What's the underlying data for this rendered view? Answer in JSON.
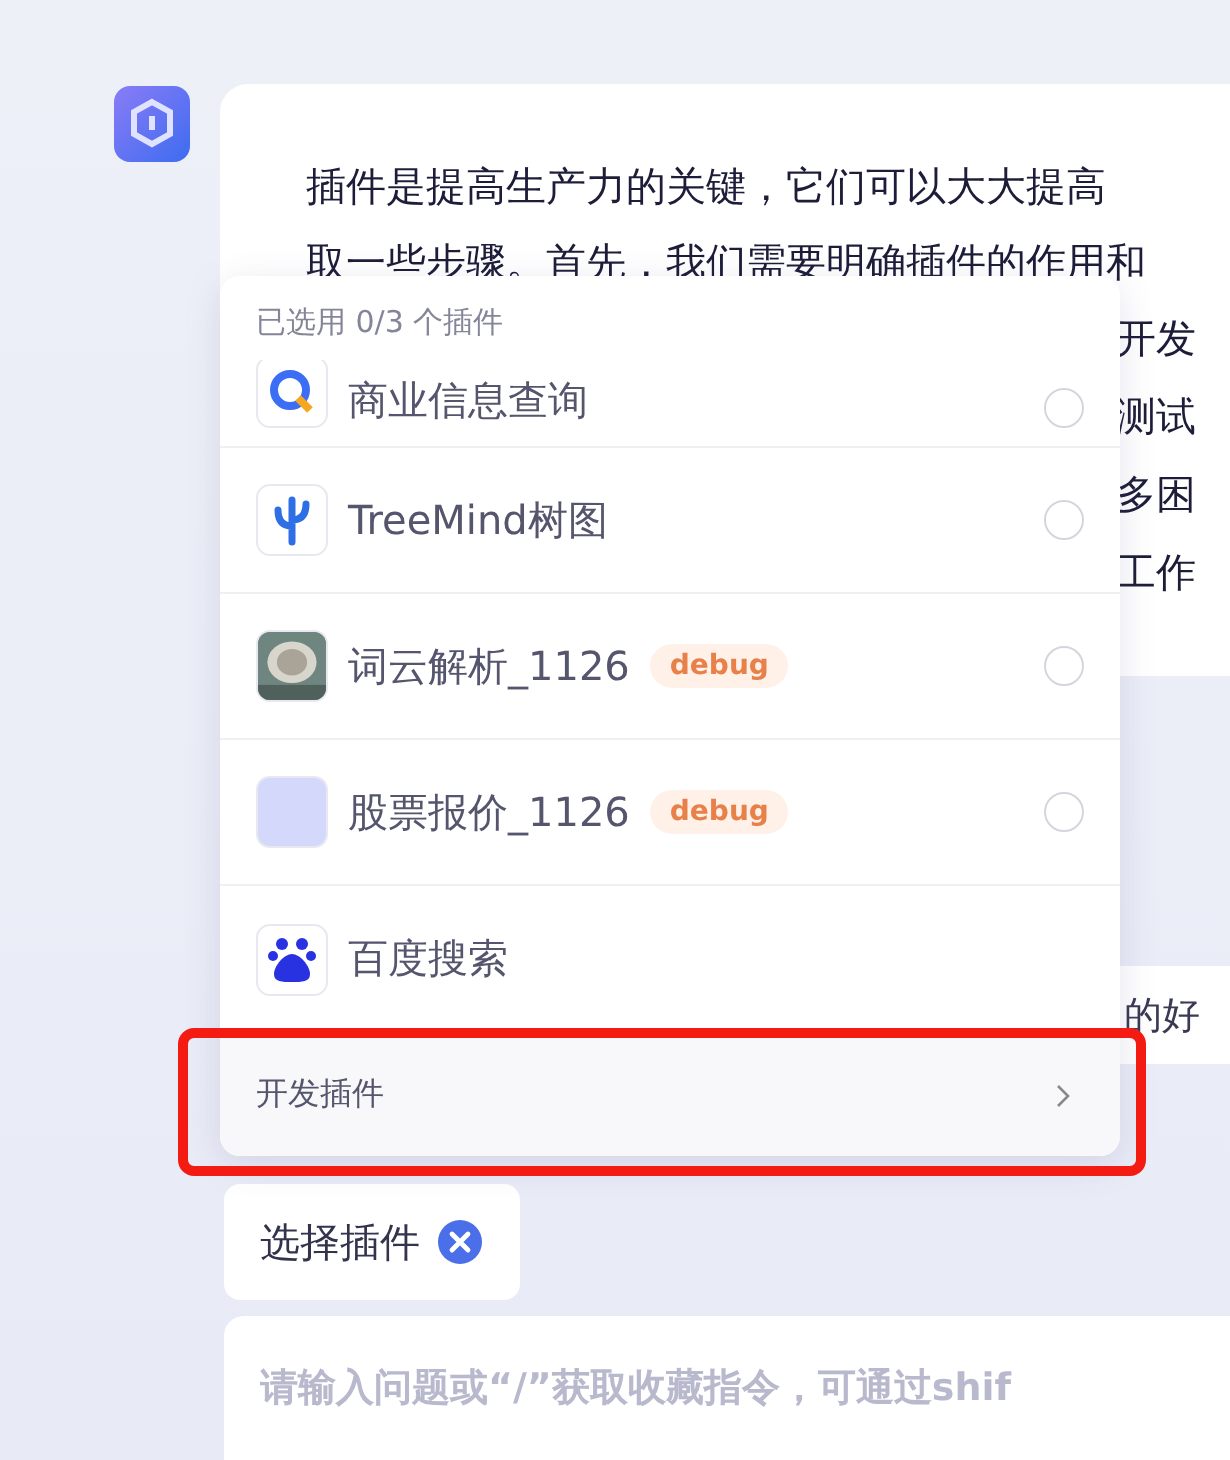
{
  "assistant_message": {
    "lines": [
      "插件是提高生产力的关键，它们可以大大提高",
      "取一些步骤。首先，我们需要明确插件的作用和"
    ],
    "line_ends": [
      "开发",
      "测试",
      "多困",
      "工作"
    ]
  },
  "plugin_popup": {
    "header": "已选用 0/3 个插件",
    "plugins": [
      {
        "name": "商业信息查询",
        "kind": "magnifier",
        "selected": false
      },
      {
        "name": "TreeMind树图",
        "kind": "tree",
        "selected": false
      },
      {
        "name": "词云解析_1126",
        "kind": "picture",
        "badge": "debug",
        "selected": false
      },
      {
        "name": "股票报价_1126",
        "kind": "blank",
        "badge": "debug",
        "selected": false
      },
      {
        "name": "百度搜索",
        "kind": "paw"
      }
    ],
    "footer": "开发插件",
    "footer_highlighted": true
  },
  "second_message": {
    "text": "的好"
  },
  "selected_chip": {
    "label": "选择插件"
  },
  "input": {
    "placeholder": "请输入问题或“/”获取收藏指令，可通过shif"
  }
}
